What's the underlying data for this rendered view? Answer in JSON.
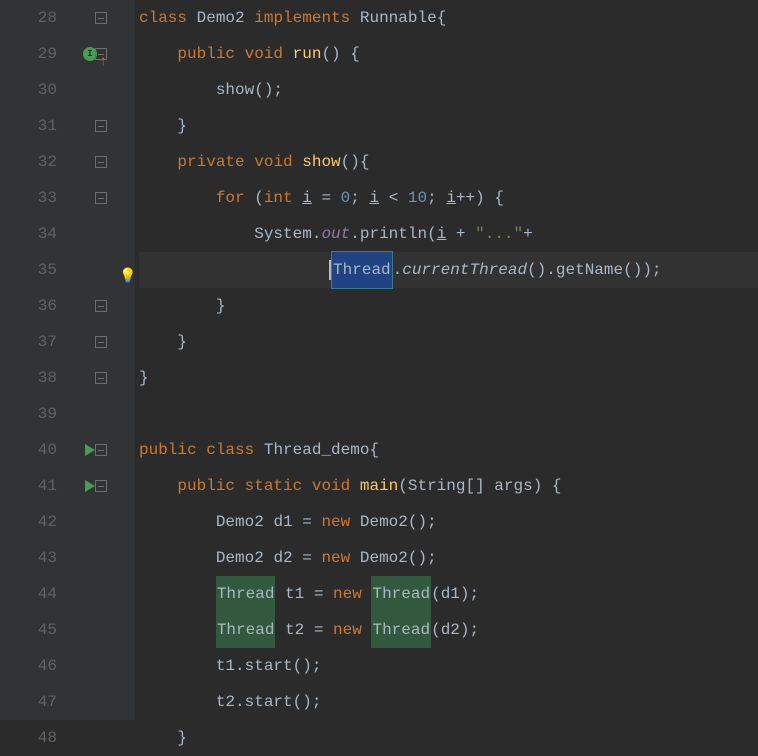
{
  "lines": [
    {
      "num": 28
    },
    {
      "num": 29
    },
    {
      "num": 30
    },
    {
      "num": 31
    },
    {
      "num": 32
    },
    {
      "num": 33
    },
    {
      "num": 34
    },
    {
      "num": 35
    },
    {
      "num": 36
    },
    {
      "num": 37
    },
    {
      "num": 38
    },
    {
      "num": 39
    },
    {
      "num": 40
    },
    {
      "num": 41
    },
    {
      "num": 42
    },
    {
      "num": 43
    },
    {
      "num": 44
    },
    {
      "num": 45
    },
    {
      "num": 46
    },
    {
      "num": 47
    },
    {
      "num": 48
    }
  ],
  "code": {
    "l28": {
      "kw1": "class",
      "name": "Demo2",
      "kw2": "implements",
      "iface": "Runnable",
      "brace": "{"
    },
    "l29": {
      "kw1": "public",
      "kw2": "void",
      "method": "run",
      "suffix": "() {"
    },
    "l30": {
      "call": "show",
      "suffix": "();"
    },
    "l31": {
      "brace": "}"
    },
    "l32": {
      "kw1": "private",
      "kw2": "void",
      "method": "show",
      "suffix": "(){"
    },
    "l33": {
      "kw1": "for",
      "open": " (",
      "kw2": "int",
      "var": "i",
      "eq": " = ",
      "n0": "0",
      "semi1": "; ",
      "var2": "i",
      "lt": " < ",
      "n10": "10",
      "semi2": "; ",
      "var3": "i",
      "inc": "++",
      "close": ") {"
    },
    "l34": {
      "cls": "System",
      "dot1": ".",
      "field": "out",
      "dot2": ".",
      "method": "println",
      "open": "(",
      "var": "i",
      "plus1": " + ",
      "str": "\"...\"",
      "plus2": "+"
    },
    "l35": {
      "cls": "Thread",
      "dot1": ".",
      "method1": "currentThread",
      "par1": "()",
      "dot2": ".",
      "method2": "getName",
      "par2": "()",
      "close": ");"
    },
    "l36": {
      "brace": "}"
    },
    "l37": {
      "brace": "}"
    },
    "l38": {
      "brace": "}"
    },
    "l40": {
      "kw1": "public",
      "kw2": "class",
      "name": "Thread_demo",
      "brace": "{"
    },
    "l41": {
      "kw1": "public",
      "kw2": "static",
      "kw3": "void",
      "method": "main",
      "open": "(",
      "type": "String",
      "arr": "[] ",
      "arg": "args",
      "close": ") {"
    },
    "l42": {
      "type": "Demo2",
      "var": "d1",
      "eq": " = ",
      "kw": "new",
      "ctor": "Demo2",
      "suffix": "();"
    },
    "l43": {
      "type": "Demo2",
      "var": "d2",
      "eq": " = ",
      "kw": "new",
      "ctor": "Demo2",
      "suffix": "();"
    },
    "l44": {
      "type": "Thread",
      "var": "t1",
      "eq": " = ",
      "kw": "new",
      "ctor": "Thread",
      "open": "(",
      "arg": "d1",
      "close": ");"
    },
    "l45": {
      "type": "Thread",
      "var": "t2",
      "eq": " = ",
      "kw": "new",
      "ctor": "Thread",
      "open": "(",
      "arg": "d2",
      "close": ");"
    },
    "l46": {
      "var": "t1",
      "dot": ".",
      "method": "start",
      "suffix": "();"
    },
    "l47": {
      "var": "t2",
      "dot": ".",
      "method": "start",
      "suffix": "();"
    },
    "l48": {
      "brace": "}"
    }
  }
}
